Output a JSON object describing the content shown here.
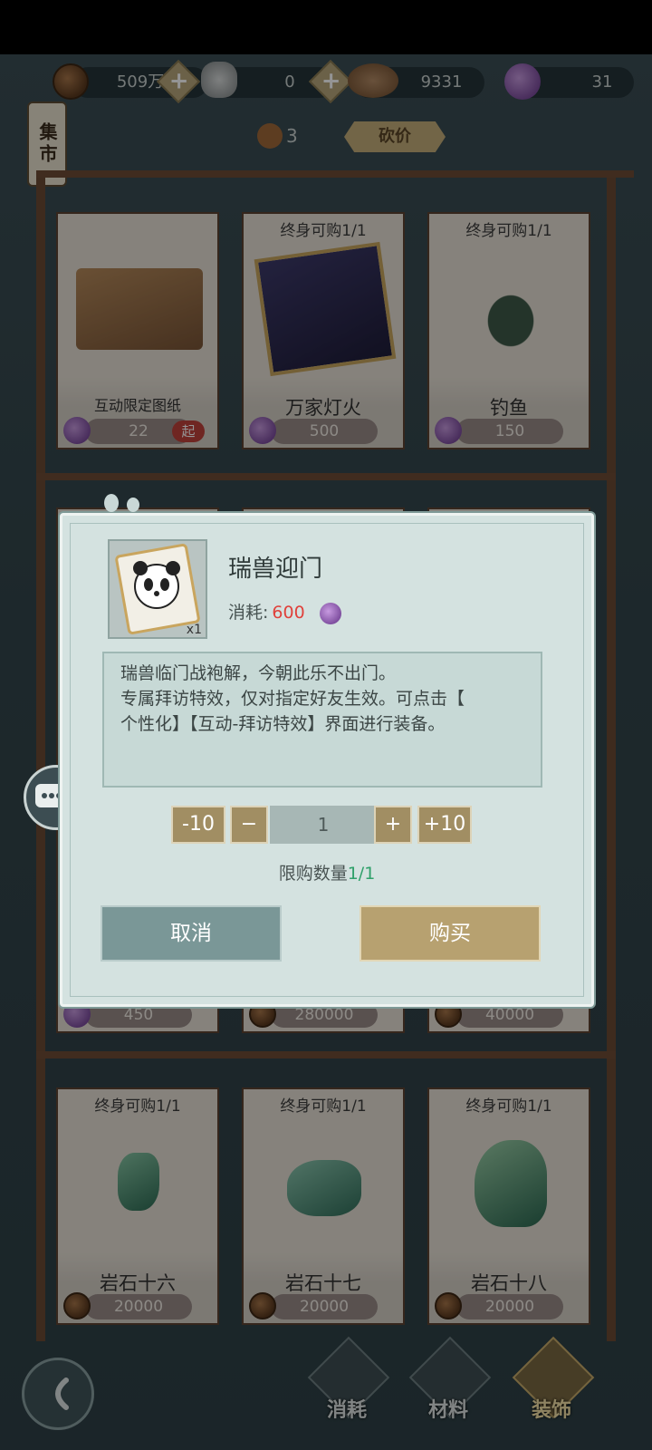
{
  "currency": {
    "coins": "509万",
    "silver": "0",
    "shells": "9331",
    "roses": "31"
  },
  "market_tab": "集市",
  "bargain": {
    "count": "3",
    "label": "砍价"
  },
  "shelf1": [
    {
      "limit": "",
      "name": "互动限定图纸",
      "price": "22",
      "badge": "起",
      "currency": "rose"
    },
    {
      "limit": "终身可购1/1",
      "name": "万家灯火",
      "price": "500",
      "currency": "rose"
    },
    {
      "limit": "终身可购1/1",
      "name": "钓鱼",
      "price": "150",
      "currency": "rose"
    }
  ],
  "shelf2_prices": [
    {
      "price": "450",
      "currency": "rose"
    },
    {
      "price": "280000",
      "currency": "coin"
    },
    {
      "price": "40000",
      "currency": "coin"
    }
  ],
  "shelf3": [
    {
      "limit": "终身可购1/1",
      "name": "岩石十六",
      "price": "20000",
      "currency": "coin"
    },
    {
      "limit": "终身可购1/1",
      "name": "岩石十七",
      "price": "20000",
      "currency": "coin"
    },
    {
      "limit": "终身可购1/1",
      "name": "岩石十八",
      "price": "20000",
      "currency": "coin"
    }
  ],
  "dialog": {
    "item_name": "瑞兽迎门",
    "cost_label": "消耗:",
    "cost_value": "600",
    "thumb_count": "x1",
    "description": "瑞兽临门战袍解，今朝此乐不出门。\n专属拜访特效，仅对指定好友生效。可点击【\n个性化】【互动-拜访特效】界面进行装备。",
    "minus10": "-10",
    "minus": "−",
    "quantity": "1",
    "plus": "+",
    "plus10": "+10",
    "limit_label": "限购数量",
    "limit_value": "1/1",
    "cancel": "取消",
    "buy": "购买"
  },
  "bottom_nav": [
    {
      "label": "消耗"
    },
    {
      "label": "材料"
    },
    {
      "label": "装饰"
    }
  ],
  "colors": {
    "accent_gold": "#b7a170",
    "cancel_teal": "#7a9797",
    "cost_red": "#e0413b",
    "limit_green": "#2fa06a"
  }
}
